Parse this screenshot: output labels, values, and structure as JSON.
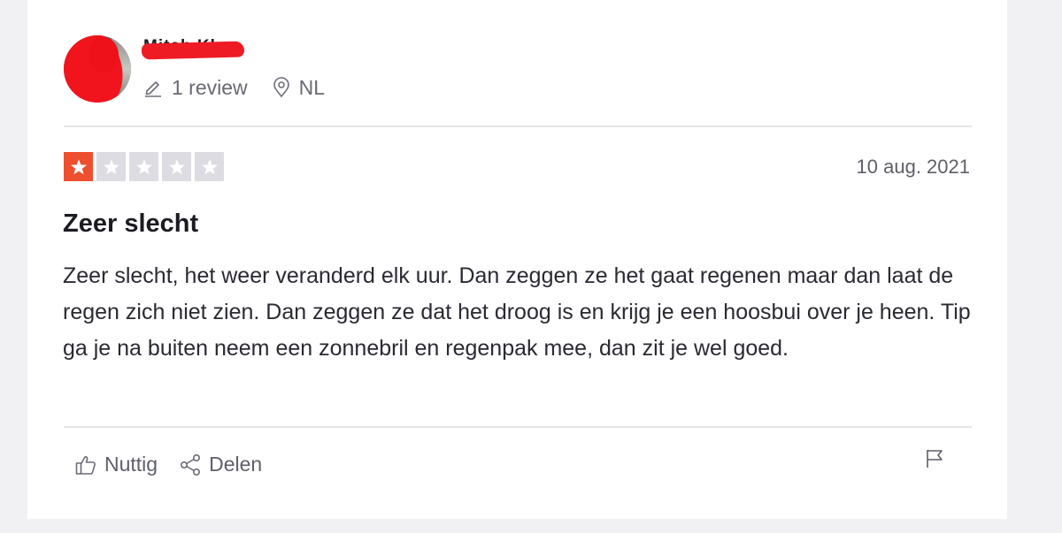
{
  "reviewer": {
    "name": "Mitch Kh",
    "review_count": "1 review",
    "country": "NL"
  },
  "review": {
    "rating": 1,
    "max_rating": 5,
    "date": "10 aug. 2021",
    "title": "Zeer slecht",
    "body": "Zeer slecht, het weer veranderd elk uur. Dan zeggen ze het gaat regenen maar dan laat de regen zich niet zien. Dan zeggen ze dat het droog is en krijg je een hoosbui over je heen. Tip ga je na buiten neem een zonnebril en regenpak mee, dan zit je wel goed."
  },
  "actions": {
    "useful_label": "Nuttig",
    "share_label": "Delen"
  },
  "icons": {
    "reviews": "pencil-icon",
    "location": "location-pin-icon",
    "useful": "thumbs-up-icon",
    "share": "share-icon",
    "report": "flag-icon"
  },
  "colors": {
    "star_active": "#ee4f2e",
    "star_inactive": "#dcdce2",
    "redaction": "#ee1b24"
  }
}
